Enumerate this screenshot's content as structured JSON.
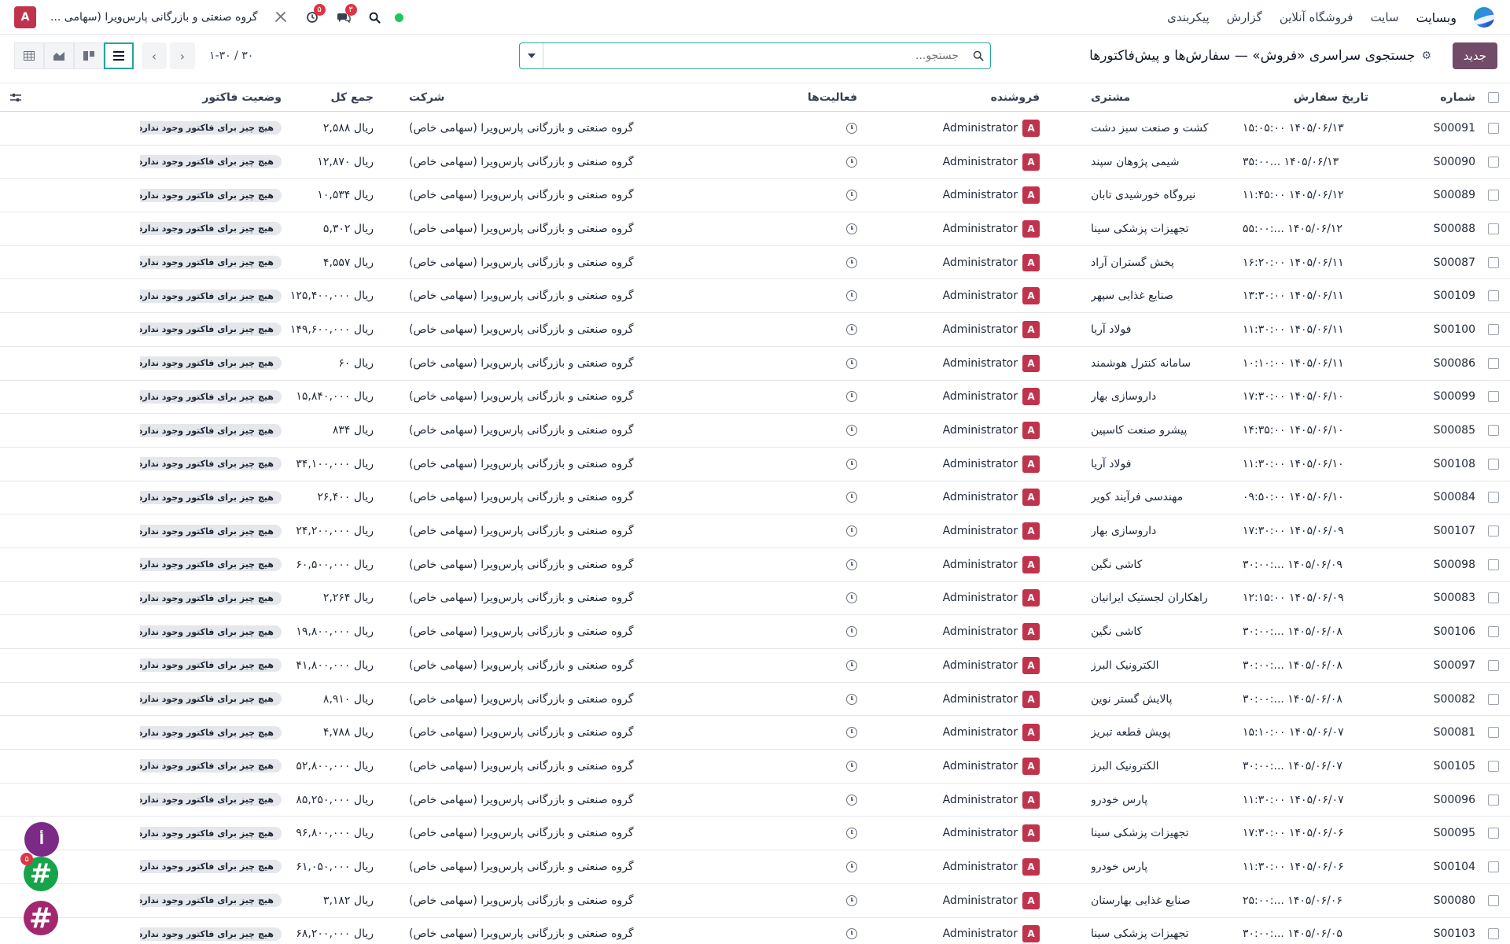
{
  "navbar": {
    "brand": "وبسایت",
    "menu": [
      "سایت",
      "فروشگاه آنلاین",
      "گزارش",
      "پیکربندی"
    ],
    "company": "گروه صنعتی و بازرگانی پارس‌ویرا (سهامی ...",
    "user_initial": "A",
    "messages_badge": "۳",
    "activities_badge": "۵"
  },
  "control": {
    "new_button": "جدید",
    "title": "جستجوی سراسری «فروش» — سفارش‌ها و پیش‌فاکتورها",
    "search_placeholder": "جستجو...",
    "pager": "۱-۳۰ / ۳۰"
  },
  "columns": {
    "number": "شماره",
    "date": "تاریخ سفارش",
    "customer": "مشتری",
    "seller": "فروشنده",
    "activities": "فعالیت‌ها",
    "company": "شرکت",
    "total": "جمع کل",
    "invoice_status": "وضعیت فاکتور"
  },
  "rows": [
    {
      "num": "S00091",
      "date": "۱۴۰۵/۰۶/۱۳ ۱۵:۰۵:۰۰",
      "customer": "کشت و صنعت سبز دشت",
      "seller": "Administrator",
      "company": "گروه صنعتی و بازرگانی پارس‌ویرا (سهامی خاص)",
      "total": "ریال ۲,۵۸۸",
      "status": "هیچ چیز برای فاکتور وجود ندارد"
    },
    {
      "num": "S00090",
      "date": "۱۴۰۵/۰۶/۱۳ ...۳۵:۰۰",
      "customer": "شیمی پژوهان سپند",
      "seller": "Administrator",
      "company": "گروه صنعتی و بازرگانی پارس‌ویرا (سهامی خاص)",
      "total": "ریال ۱۲,۸۷۰",
      "status": "هیچ چیز برای فاکتور وجود ندارد"
    },
    {
      "num": "S00089",
      "date": "۱۴۰۵/۰۶/۱۲ ۱۱:۴۵:۰۰",
      "customer": "نیروگاه خورشیدی تابان",
      "seller": "Administrator",
      "company": "گروه صنعتی و بازرگانی پارس‌ویرا (سهامی خاص)",
      "total": "ریال ۱۰,۵۳۴",
      "status": "هیچ چیز برای فاکتور وجود ندارد"
    },
    {
      "num": "S00088",
      "date": "۱۴۰۵/۰۶/۱۲ ...:۵۵:۰۰",
      "customer": "تجهیزات پزشکی سینا",
      "seller": "Administrator",
      "company": "گروه صنعتی و بازرگانی پارس‌ویرا (سهامی خاص)",
      "total": "ریال ۵,۳۰۲",
      "status": "هیچ چیز برای فاکتور وجود ندارد"
    },
    {
      "num": "S00087",
      "date": "۱۴۰۵/۰۶/۱۱ ۱۶:۲۰:۰۰",
      "customer": "پخش گستران آراد",
      "seller": "Administrator",
      "company": "گروه صنعتی و بازرگانی پارس‌ویرا (سهامی خاص)",
      "total": "ریال ۴,۵۵۷",
      "status": "هیچ چیز برای فاکتور وجود ندارد"
    },
    {
      "num": "S00109",
      "date": "۱۴۰۵/۰۶/۱۱ ۱۳:۳۰:۰۰",
      "customer": "صنایع غذایی سپهر",
      "seller": "Administrator",
      "company": "گروه صنعتی و بازرگانی پارس‌ویرا (سهامی خاص)",
      "total": "ریال ۱۲۵,۴۰۰,۰۰۰",
      "status": "هیچ چیز برای فاکتور وجود ندارد"
    },
    {
      "num": "S00100",
      "date": "۱۴۰۵/۰۶/۱۱ ۱۱:۳۰:۰۰",
      "customer": "فولاد آریا",
      "seller": "Administrator",
      "company": "گروه صنعتی و بازرگانی پارس‌ویرا (سهامی خاص)",
      "total": "ریال ۱۴۹,۶۰۰,۰۰۰",
      "status": "هیچ چیز برای فاکتور وجود ندارد"
    },
    {
      "num": "S00086",
      "date": "۱۴۰۵/۰۶/۱۱ ۱۰:۱۰:۰۰",
      "customer": "سامانه کنترل هوشمند",
      "seller": "Administrator",
      "company": "گروه صنعتی و بازرگانی پارس‌ویرا (سهامی خاص)",
      "total": "ریال ۶۰",
      "status": "هیچ چیز برای فاکتور وجود ندارد"
    },
    {
      "num": "S00099",
      "date": "۱۴۰۵/۰۶/۱۰ ۱۷:۳۰:۰۰",
      "customer": "داروسازی بهار",
      "seller": "Administrator",
      "company": "گروه صنعتی و بازرگانی پارس‌ویرا (سهامی خاص)",
      "total": "ریال ۱۵,۸۴۰,۰۰۰",
      "status": "هیچ چیز برای فاکتور وجود ندارد"
    },
    {
      "num": "S00085",
      "date": "۱۴۰۵/۰۶/۱۰ ۱۴:۳۵:۰۰",
      "customer": "پیشرو صنعت کاسپین",
      "seller": "Administrator",
      "company": "گروه صنعتی و بازرگانی پارس‌ویرا (سهامی خاص)",
      "total": "ریال ۸۳۴",
      "status": "هیچ چیز برای فاکتور وجود ندارد"
    },
    {
      "num": "S00108",
      "date": "۱۴۰۵/۰۶/۱۰ ۱۱:۳۰:۰۰",
      "customer": "فولاد آریا",
      "seller": "Administrator",
      "company": "گروه صنعتی و بازرگانی پارس‌ویرا (سهامی خاص)",
      "total": "ریال ۳۴,۱۰۰,۰۰۰",
      "status": "هیچ چیز برای فاکتور وجود ندارد"
    },
    {
      "num": "S00084",
      "date": "۱۴۰۵/۰۶/۱۰ ۰۹:۵۰:۰۰",
      "customer": "مهندسی فرآیند کویر",
      "seller": "Administrator",
      "company": "گروه صنعتی و بازرگانی پارس‌ویرا (سهامی خاص)",
      "total": "ریال ۲۶,۴۰۰",
      "status": "هیچ چیز برای فاکتور وجود ندارد"
    },
    {
      "num": "S00107",
      "date": "۱۴۰۵/۰۶/۰۹ ۱۷:۳۰:۰۰",
      "customer": "داروسازی بهار",
      "seller": "Administrator",
      "company": "گروه صنعتی و بازرگانی پارس‌ویرا (سهامی خاص)",
      "total": "ریال ۲۴,۲۰۰,۰۰۰",
      "status": "هیچ چیز برای فاکتور وجود ندارد"
    },
    {
      "num": "S00098",
      "date": "۱۴۰۵/۰۶/۰۹ ...:۳۰:۰۰",
      "customer": "کاشی نگین",
      "seller": "Administrator",
      "company": "گروه صنعتی و بازرگانی پارس‌ویرا (سهامی خاص)",
      "total": "ریال ۶۰,۵۰۰,۰۰۰",
      "status": "هیچ چیز برای فاکتور وجود ندارد"
    },
    {
      "num": "S00083",
      "date": "۱۴۰۵/۰۶/۰۹ ۱۲:۱۵:۰۰",
      "customer": "راهکاران لجستیک ایرانیان",
      "seller": "Administrator",
      "company": "گروه صنعتی و بازرگانی پارس‌ویرا (سهامی خاص)",
      "total": "ریال ۲,۲۶۴",
      "status": "هیچ چیز برای فاکتور وجود ندارد"
    },
    {
      "num": "S00106",
      "date": "۱۴۰۵/۰۶/۰۸ ...:۳۰:۰۰",
      "customer": "کاشی نگین",
      "seller": "Administrator",
      "company": "گروه صنعتی و بازرگانی پارس‌ویرا (سهامی خاص)",
      "total": "ریال ۱۹,۸۰۰,۰۰۰",
      "status": "هیچ چیز برای فاکتور وجود ندارد"
    },
    {
      "num": "S00097",
      "date": "۱۴۰۵/۰۶/۰۸ ...:۳۰:۰۰",
      "customer": "الکترونیک البرز",
      "seller": "Administrator",
      "company": "گروه صنعتی و بازرگانی پارس‌ویرا (سهامی خاص)",
      "total": "ریال ۴۱,۸۰۰,۰۰۰",
      "status": "هیچ چیز برای فاکتور وجود ندارد"
    },
    {
      "num": "S00082",
      "date": "۱۴۰۵/۰۶/۰۸ ...:۳۰:۰۰",
      "customer": "پالایش گستر نوین",
      "seller": "Administrator",
      "company": "گروه صنعتی و بازرگانی پارس‌ویرا (سهامی خاص)",
      "total": "ریال ۸,۹۱۰",
      "status": "هیچ چیز برای فاکتور وجود ندارد"
    },
    {
      "num": "S00081",
      "date": "۱۴۰۵/۰۶/۰۷ ۱۵:۱۰:۰۰",
      "customer": "پویش قطعه تبریز",
      "seller": "Administrator",
      "company": "گروه صنعتی و بازرگانی پارس‌ویرا (سهامی خاص)",
      "total": "ریال ۴,۷۸۸",
      "status": "هیچ چیز برای فاکتور وجود ندارد"
    },
    {
      "num": "S00105",
      "date": "۱۴۰۵/۰۶/۰۷ ...:۳۰:۰۰",
      "customer": "الکترونیک البرز",
      "seller": "Administrator",
      "company": "گروه صنعتی و بازرگانی پارس‌ویرا (سهامی خاص)",
      "total": "ریال ۵۲,۸۰۰,۰۰۰",
      "status": "هیچ چیز برای فاکتور وجود ندارد"
    },
    {
      "num": "S00096",
      "date": "۱۴۰۵/۰۶/۰۷ ۱۱:۳۰:۰۰",
      "customer": "پارس خودرو",
      "seller": "Administrator",
      "company": "گروه صنعتی و بازرگانی پارس‌ویرا (سهامی خاص)",
      "total": "ریال ۸۵,۲۵۰,۰۰۰",
      "status": "هیچ چیز برای فاکتور وجود ندارد"
    },
    {
      "num": "S00095",
      "date": "۱۴۰۵/۰۶/۰۶ ۱۷:۳۰:۰۰",
      "customer": "تجهیزات پزشکی سینا",
      "seller": "Administrator",
      "company": "گروه صنعتی و بازرگانی پارس‌ویرا (سهامی خاص)",
      "total": "ریال ۹۶,۸۰۰,۰۰۰",
      "status": "هیچ چیز برای فاکتور وجود ندارد"
    },
    {
      "num": "S00104",
      "date": "۱۴۰۵/۰۶/۰۶ ۱۱:۳۰:۰۰",
      "customer": "پارس خودرو",
      "seller": "Administrator",
      "company": "گروه صنعتی و بازرگانی پارس‌ویرا (سهامی خاص)",
      "total": "ریال ۶۱,۰۵۰,۰۰۰",
      "status": "هیچ چیز برای فاکتور وجود ندارد"
    },
    {
      "num": "S00080",
      "date": "۱۴۰۵/۰۶/۰۶ ...:۲۵:۰۰",
      "customer": "صنایع غذایی بهارستان",
      "seller": "Administrator",
      "company": "گروه صنعتی و بازرگانی پارس‌ویرا (سهامی خاص)",
      "total": "ریال ۳,۱۸۲",
      "status": "هیچ چیز برای فاکتور وجود ندارد"
    },
    {
      "num": "S00103",
      "date": "۱۴۰۵/۰۶/۰۵ ...:۳۰:۰۰",
      "customer": "تجهیزات پزشکی سینا",
      "seller": "Administrator",
      "company": "گروه صنعتی و بازرگانی پارس‌ویرا (سهامی خاص)",
      "total": "ریال ۶۸,۲۰۰,۰۰۰",
      "status": "هیچ چیز برای فاکتور وجود ندارد"
    }
  ],
  "bubbles": {
    "top_letter": "أ",
    "hash": "#",
    "badge": "۵"
  },
  "colors": {
    "brand": "#714b67",
    "accent": "#22a699",
    "avatar": "#c0334d",
    "online": "#22c55e"
  }
}
